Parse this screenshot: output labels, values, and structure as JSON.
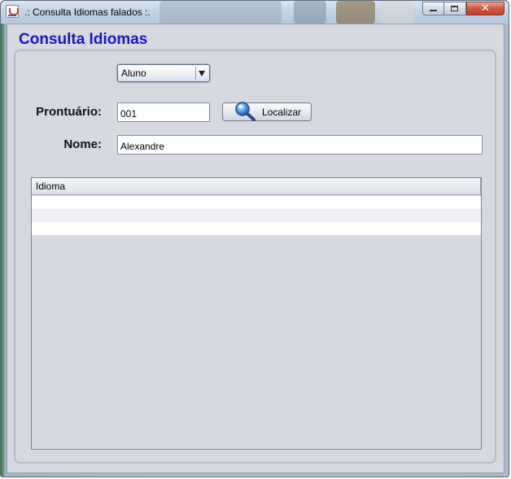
{
  "window": {
    "title": ".: Consulta Idiomas falados :.",
    "controls": {
      "minimize": "",
      "maximize": "",
      "close": "✕"
    }
  },
  "form": {
    "heading": "Consulta Idiomas",
    "type_select": {
      "selected": "Aluno"
    },
    "prontuario": {
      "label": "Prontuário:",
      "value": "001"
    },
    "locate_button": {
      "label": "Localizar"
    },
    "nome": {
      "label": "Nome:",
      "value": "Alexandre"
    }
  },
  "table": {
    "columns": [
      "Idioma"
    ],
    "rows": [
      [
        ""
      ],
      [
        ""
      ],
      [
        ""
      ]
    ]
  },
  "colors": {
    "heading": "#1717c4",
    "close_button": "#c0402a",
    "panel_bg": "#d6d9df"
  },
  "icons": {
    "app": "java-cup-icon",
    "locate": "magnifier-icon",
    "combo": "chevron-down-icon"
  }
}
